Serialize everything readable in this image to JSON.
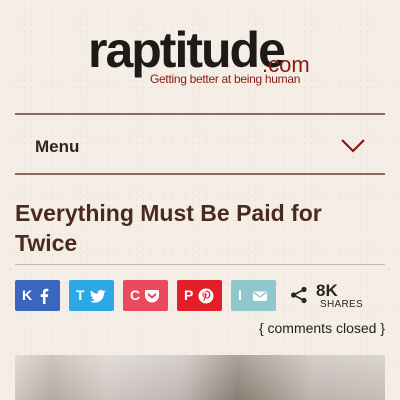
{
  "logo": {
    "main": "raptitude",
    "dotcom": ".com",
    "tagline": "Getting better at being human"
  },
  "nav": {
    "menu_label": "Menu",
    "toggle_icon": "chevron-down-icon"
  },
  "article": {
    "title": "Everything Must Be Paid for Twice"
  },
  "share": {
    "buttons": [
      {
        "letter": "K",
        "icon": "facebook-icon",
        "color": "#3a66c0"
      },
      {
        "letter": "T",
        "icon": "twitter-icon",
        "color": "#2ea7e6"
      },
      {
        "letter": "C",
        "icon": "pocket-icon",
        "color": "#ea4a5c"
      },
      {
        "letter": "P",
        "icon": "pinterest-icon",
        "color": "#e31e2a"
      },
      {
        "letter": "I",
        "icon": "email-icon",
        "color": "#8fc7cc"
      }
    ],
    "total_icon": "share-icon",
    "count": "8K",
    "count_label": "SHARES"
  },
  "comments": {
    "text": "{ comments closed }"
  },
  "colors": {
    "background": "#f5eee6",
    "rule": "#8a6b59",
    "accent": "#8a1a10"
  }
}
